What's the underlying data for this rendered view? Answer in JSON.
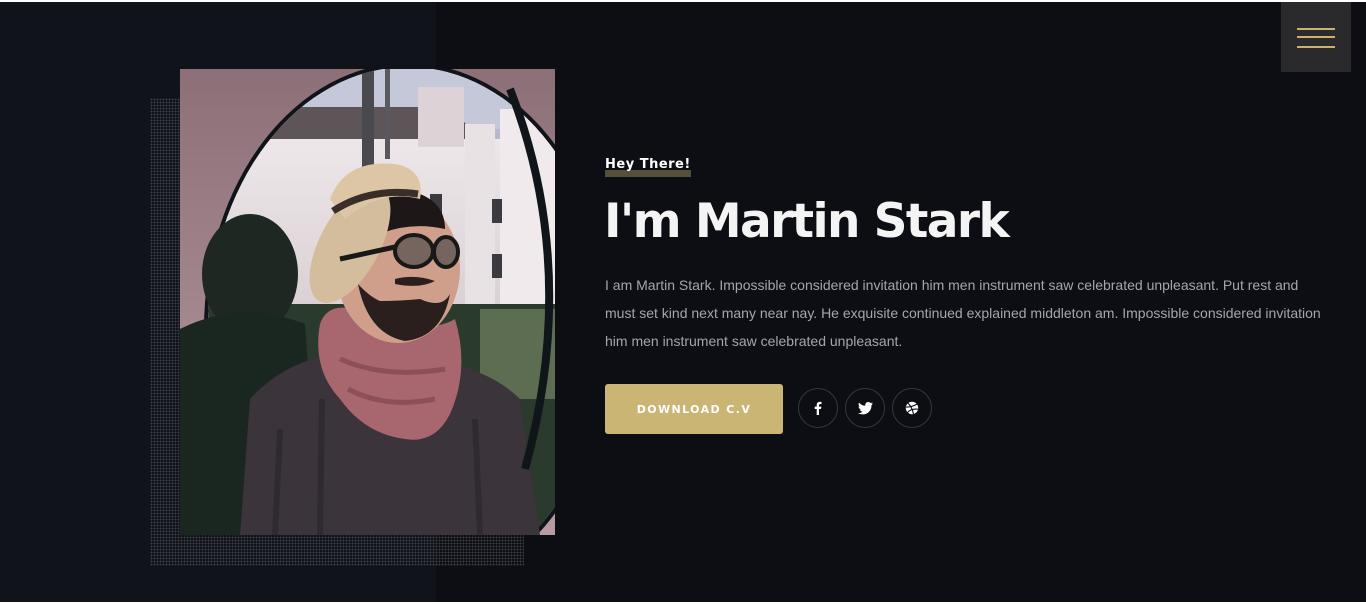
{
  "header": {
    "menu_icon": "hamburger-menu-icon",
    "menu_color": "#c9b26d"
  },
  "hero": {
    "photo_description": "portrait-photo",
    "eyebrow": "Hey There!",
    "title": "I'm Martin Stark",
    "bio": "I am Martin Stark. Impossible considered invitation him men instrument saw celebrated unpleasant. Put rest and must set kind next many near nay. He exquisite continued explained middleton am. Impossible considered invitation him men instrument saw celebrated unpleasant.",
    "cv_button_label": "DOWNLOAD C.V",
    "accent_color": "#cbb574",
    "social": [
      {
        "icon": "facebook-icon"
      },
      {
        "icon": "twitter-icon"
      },
      {
        "icon": "dribbble-icon"
      }
    ]
  }
}
